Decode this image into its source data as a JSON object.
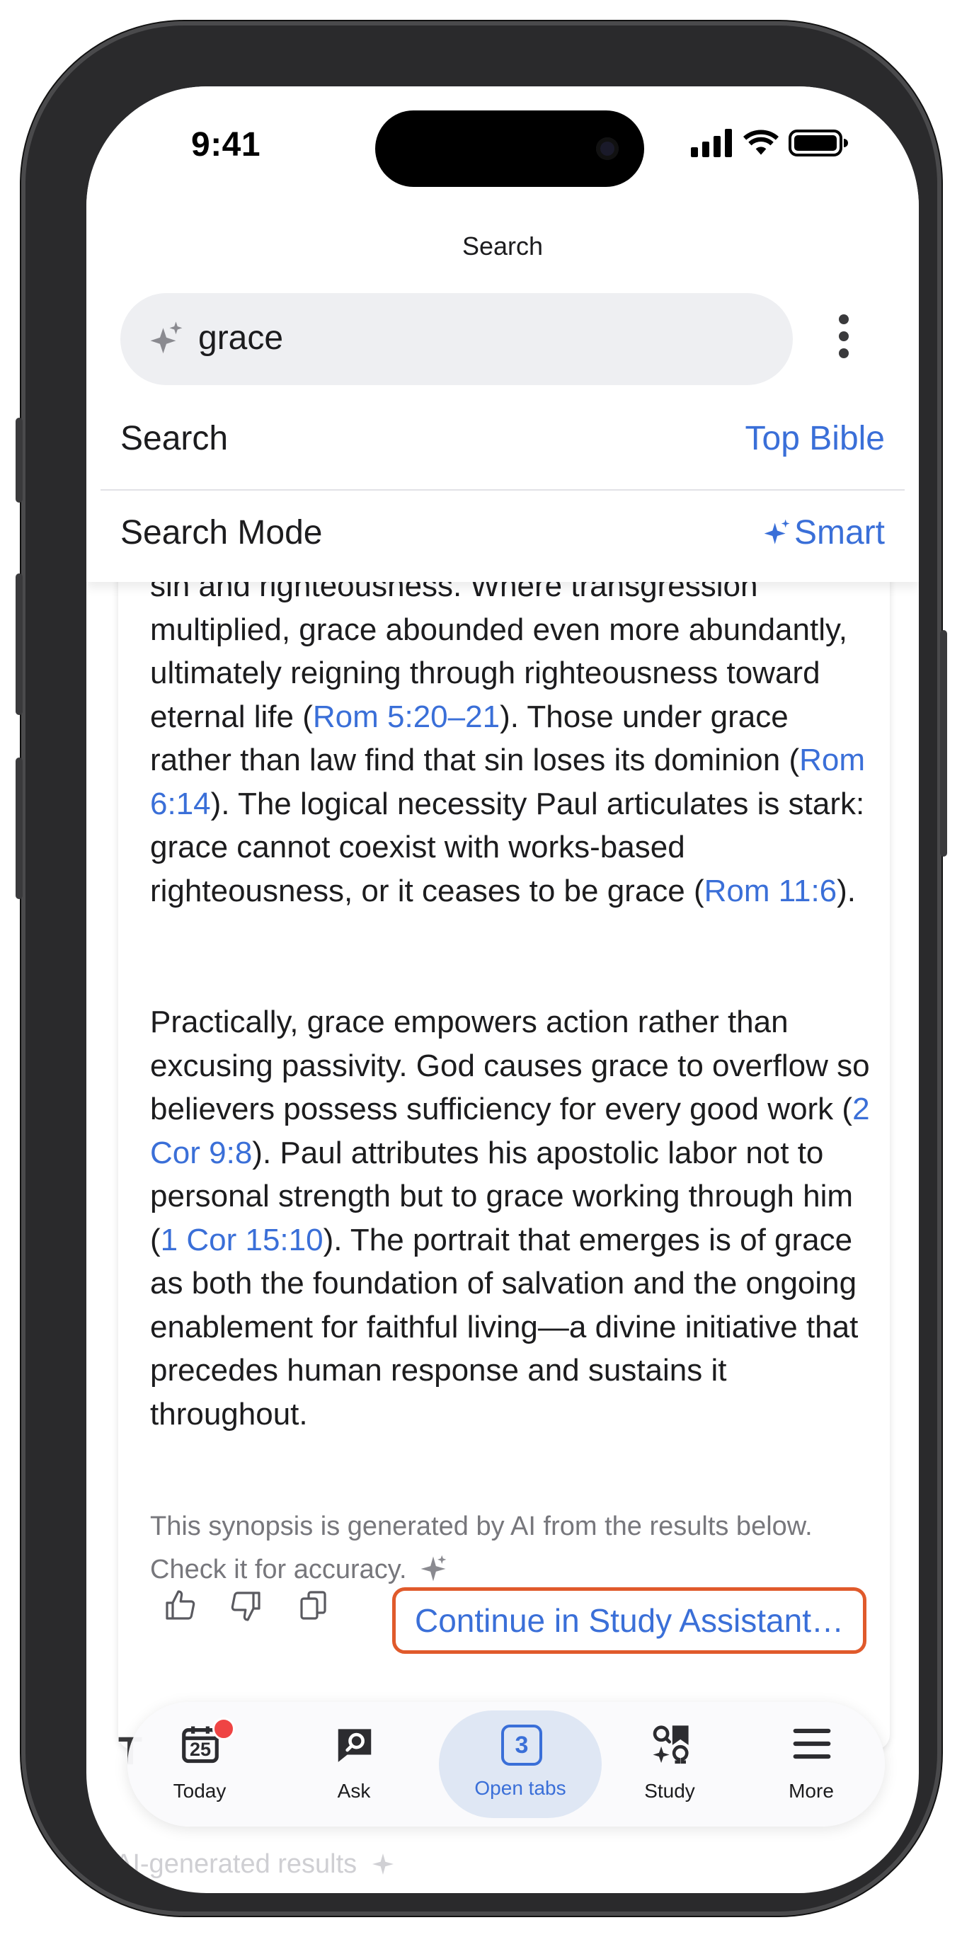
{
  "status_bar": {
    "time": "9:41"
  },
  "header": {
    "title": "Search",
    "search_query": "grace",
    "search_label": "Search",
    "search_value": "Top Bible",
    "mode_label": "Search Mode",
    "mode_value": "Smart"
  },
  "synopsis": {
    "p1": [
      {
        "t": "sin and righteousness. Where transgression multiplied, grace abounded even more abundantly, ultimately reigning through righteousness toward eternal life (",
        "link": false
      },
      {
        "t": "Rom 5:20–21",
        "link": true
      },
      {
        "t": "). Those under grace rather than law find that sin loses its dominion (",
        "link": false
      },
      {
        "t": "Rom 6:14",
        "link": true
      },
      {
        "t": "). The logical necessity Paul articulates is stark: grace cannot coexist with works-based righteousness, or it ceases to be grace (",
        "link": false
      },
      {
        "t": "Rom 11:6",
        "link": true
      },
      {
        "t": ").",
        "link": false
      }
    ],
    "p2": [
      {
        "t": "Practically, grace empowers action rather than excusing passivity. God causes grace to overflow so believers possess sufficiency for every good work (",
        "link": false
      },
      {
        "t": "2 Cor 9:8",
        "link": true
      },
      {
        "t": "). Paul attributes his apostolic labor not to personal strength but to grace working through him (",
        "link": false
      },
      {
        "t": "1 Cor 15:10",
        "link": true
      },
      {
        "t": "). The portrait that emerges is of grace as both the foundation of salvation and the ongoing enablement for faithful living—a divine initiative that precedes human response and sustains it throughout.",
        "link": false
      }
    ],
    "note": "This synopsis is generated by AI from the results below. Check it for accuracy.",
    "continue_label": "Continue in Study Assistant…"
  },
  "below": {
    "partial_heading": "T",
    "ai_results_label": "AI-generated results"
  },
  "tabbar": {
    "today": "Today",
    "today_date": "25",
    "ask": "Ask",
    "open_tabs": "Open tabs",
    "open_tabs_count": "3",
    "study": "Study",
    "more": "More"
  },
  "colors": {
    "accent": "#3a6fd8",
    "highlight_border": "#e05a2b",
    "badge": "#ef4444"
  }
}
